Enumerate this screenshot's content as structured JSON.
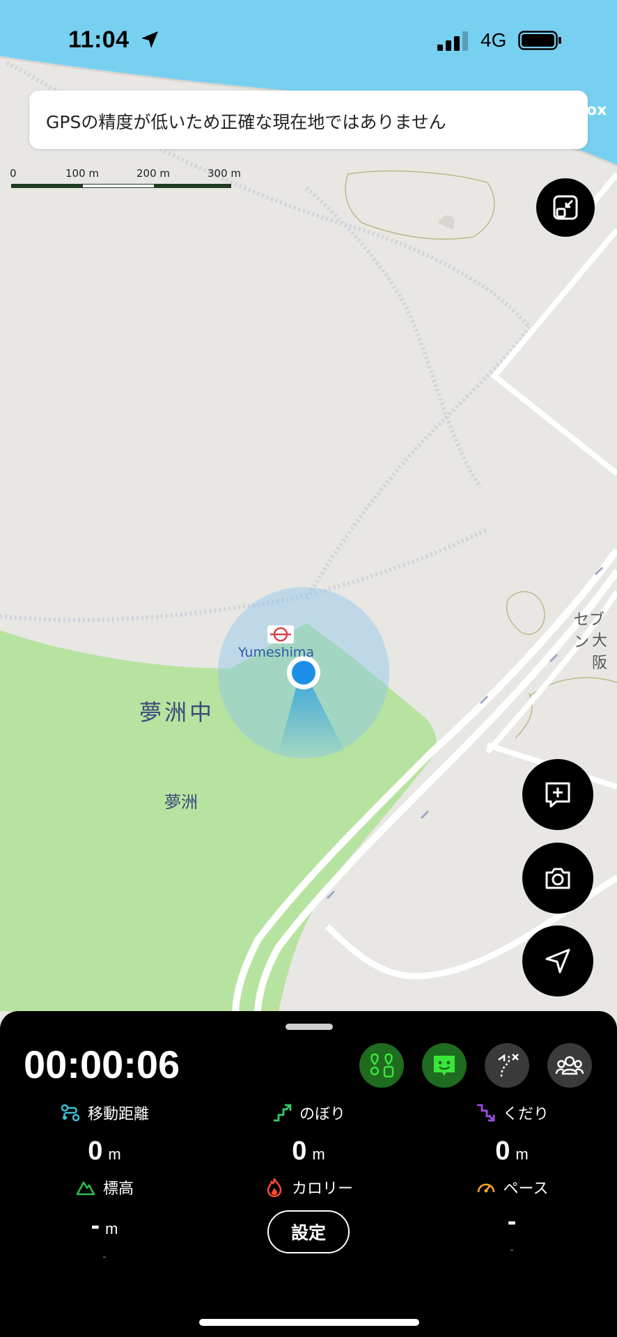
{
  "status_bar": {
    "time": "11:04",
    "network": "4G"
  },
  "gps_banner": {
    "text": "GPSの精度が低いため正確な現在地ではありません"
  },
  "map": {
    "attribution_fragment": "ox",
    "scale_labels": [
      "0",
      "100 m",
      "200 m",
      "300 m"
    ],
    "station_name": "Yumeshima",
    "labels": {
      "yumeshu_naka": "夢洲中",
      "yumeshu": "夢洲",
      "seven_fragment": "セブン",
      "osaka_fragment": "大阪"
    }
  },
  "map_controls": {
    "icons": [
      "collapse-icon",
      "add-note-icon",
      "camera-icon",
      "navigation-arrow-icon"
    ]
  },
  "tracking": {
    "elapsed_time": "00:00:06",
    "stats": {
      "distance": {
        "label": "移動距離",
        "value": "0",
        "unit": "m"
      },
      "ascent": {
        "label": "のぼり",
        "value": "0",
        "unit": "m"
      },
      "descent": {
        "label": "くだり",
        "value": "0",
        "unit": "m"
      },
      "elevation": {
        "label": "標高",
        "value": "-",
        "unit": "m",
        "sub": "-"
      },
      "calories": {
        "label": "カロリー"
      },
      "pace": {
        "label": "ペース",
        "value": "-",
        "sub": "-"
      }
    },
    "settings_label": "設定",
    "colors": {
      "active_mode": "#1f6b1f",
      "active_icon": "#39e639",
      "inactive_mode": "#3a3a3a",
      "distance_icon": "#3ac1d6",
      "ascent_icon": "#33cc66",
      "descent_icon": "#a24de0",
      "elevation_icon": "#2fbf4f",
      "calories_icon": "#ff4d2e",
      "pace_icon": "#f3a72b"
    }
  }
}
